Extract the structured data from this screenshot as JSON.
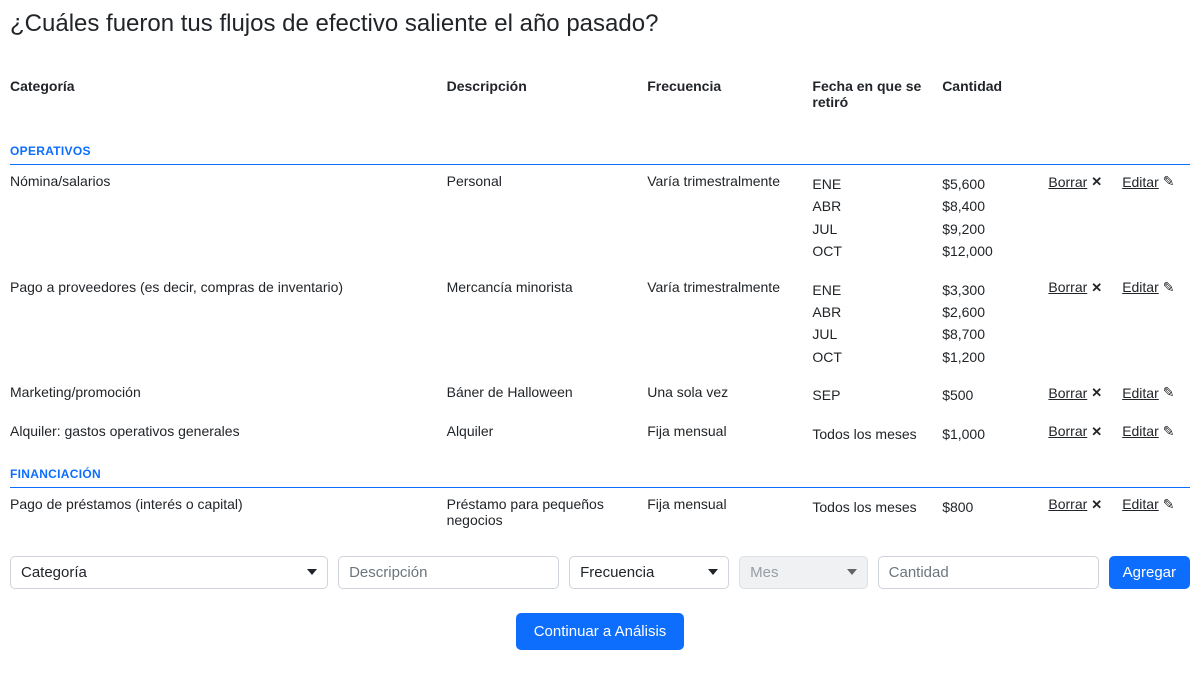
{
  "title": "¿Cuáles fueron tus flujos de efectivo saliente el año pasado?",
  "headers": {
    "category": "Categoría",
    "description": "Descripción",
    "frequency": "Frecuencia",
    "date": "Fecha en que se retiró",
    "amount": "Cantidad"
  },
  "groups": [
    {
      "label": "OPERATIVOS",
      "rows": [
        {
          "category": "Nómina/salarios",
          "description": "Personal",
          "frequency": "Varía trimestralmente",
          "entries": [
            {
              "month": "ENE",
              "amount": "$5,600"
            },
            {
              "month": "ABR",
              "amount": "$8,400"
            },
            {
              "month": "JUL",
              "amount": "$9,200"
            },
            {
              "month": "OCT",
              "amount": "$12,000"
            }
          ]
        },
        {
          "category": "Pago a proveedores (es decir, compras de inventario)",
          "description": "Mercancía minorista",
          "frequency": "Varía trimestralmente",
          "entries": [
            {
              "month": "ENE",
              "amount": "$3,300"
            },
            {
              "month": "ABR",
              "amount": "$2,600"
            },
            {
              "month": "JUL",
              "amount": "$8,700"
            },
            {
              "month": "OCT",
              "amount": "$1,200"
            }
          ]
        },
        {
          "category": "Marketing/promoción",
          "description": "Báner de Halloween",
          "frequency": "Una sola vez",
          "entries": [
            {
              "month": "SEP",
              "amount": "$500"
            }
          ]
        },
        {
          "category": "Alquiler: gastos operativos generales",
          "description": "Alquiler",
          "frequency": "Fija mensual",
          "entries": [
            {
              "month": "Todos los meses",
              "amount": "$1,000"
            }
          ]
        }
      ]
    },
    {
      "label": "FINANCIACIÓN",
      "rows": [
        {
          "category": "Pago de préstamos (interés o capital)",
          "description": "Préstamo para pequeños negocios",
          "frequency": "Fija mensual",
          "entries": [
            {
              "month": "Todos los meses",
              "amount": "$800"
            }
          ]
        }
      ]
    }
  ],
  "actions": {
    "delete": "Borrar",
    "edit": "Editar"
  },
  "form": {
    "category_placeholder": "Categoría",
    "description_placeholder": "Descripción",
    "frequency_placeholder": "Frecuencia",
    "month_placeholder": "Mes",
    "amount_placeholder": "Cantidad",
    "add_button": "Agregar"
  },
  "continue_button": "Continuar a Análisis",
  "colors": {
    "accent": "#0d6efd"
  }
}
